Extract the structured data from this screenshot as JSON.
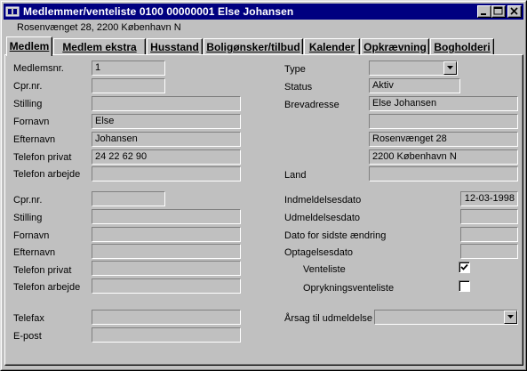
{
  "window": {
    "title": "Medlemmer/venteliste  0100 00000001 Else Johansen",
    "subtitle": "Rosenvænget 28, 2200 København N"
  },
  "tabs": [
    {
      "label": "Medlem"
    },
    {
      "label": "Medlem ekstra"
    },
    {
      "label": "Husstand"
    },
    {
      "label": "Boligønsker/tilbud"
    },
    {
      "label": "Kalender"
    },
    {
      "label": "Opkrævning"
    },
    {
      "label": "Bogholderi"
    }
  ],
  "member": {
    "medlemsnr_label": "Medlemsnr.",
    "medlemsnr": "1",
    "cpr_label": "Cpr.nr.",
    "cpr": "",
    "stilling_label": "Stilling",
    "stilling": "",
    "fornavn_label": "Fornavn",
    "fornavn": "Else",
    "efternavn_label": "Efternavn",
    "efternavn": "Johansen",
    "tlf_privat_label": "Telefon privat",
    "tlf_privat": "24 22 62 90",
    "tlf_arbejde_label": "Telefon arbejde",
    "tlf_arbejde": ""
  },
  "partner": {
    "cpr_label": "Cpr.nr.",
    "cpr": "",
    "stilling_label": "Stilling",
    "stilling": "",
    "fornavn_label": "Fornavn",
    "fornavn": "",
    "efternavn_label": "Efternavn",
    "efternavn": "",
    "tlf_privat_label": "Telefon privat",
    "tlf_privat": "",
    "tlf_arbejde_label": "Telefon arbejde",
    "tlf_arbejde": ""
  },
  "contact": {
    "telefax_label": "Telefax",
    "telefax": "",
    "epost_label": "E-post",
    "epost": ""
  },
  "right": {
    "type_label": "Type",
    "type": "",
    "status_label": "Status",
    "status": "Aktiv",
    "brevadresse_label": "Brevadresse",
    "address1": "Else Johansen",
    "address2": "",
    "address3": "Rosenvænget 28",
    "address4": "2200 København N",
    "land_label": "Land",
    "land": "",
    "indmeldelse_label": "Indmeldelsesdato",
    "indmeldelse": "12-03-1998",
    "udmeldelse_label": "Udmeldelsesdato",
    "udmeldelse": "",
    "sidste_label": "Dato for sidste ændring",
    "sidste": "",
    "optagelse_label": "Optagelsesdato",
    "optagelse": "",
    "venteliste_label": "Venteliste",
    "venteliste_checked": true,
    "opryk_label": "Oprykningsventeliste",
    "opryk_checked": false,
    "aarsag_label": "Årsag til udmeldelse",
    "aarsag": ""
  }
}
